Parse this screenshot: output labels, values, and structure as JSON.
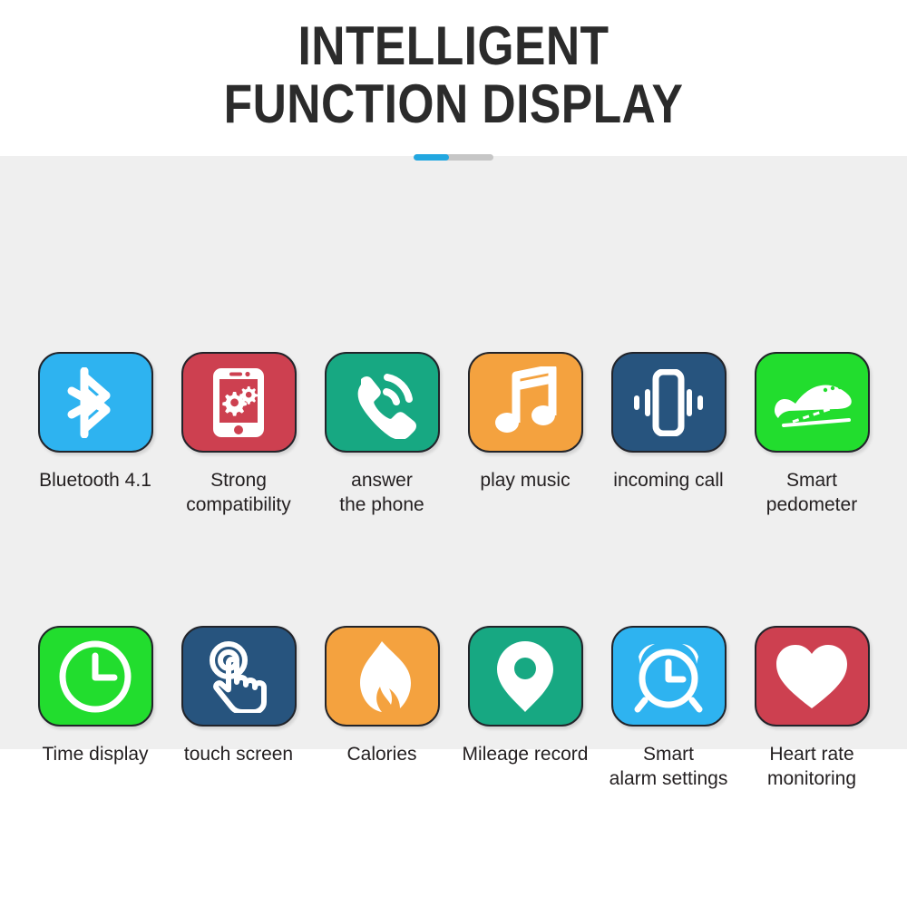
{
  "header": {
    "title_line_1": "INTELLIGENT",
    "title_line_2": "FUNCTION DISPLAY",
    "divider": {
      "fill_color": "#22a7e0",
      "track_color": "#c6c6c6",
      "fill_percent": 44
    }
  },
  "theme": {
    "page_background": "#ffffff",
    "panel_background": "#efefef",
    "title_color": "#2b2b2b",
    "label_color": "#231f20",
    "tile_outline": "#22242a",
    "icon_color": "#ffffff"
  },
  "features": [
    {
      "label": "Bluetooth 4.1",
      "icon": "bluetooth-icon",
      "color": "#2eb3f0"
    },
    {
      "label": "Strong\ncompatibility",
      "icon": "phone-gears-icon",
      "color": "#cd4050"
    },
    {
      "label": "answer\nthe phone",
      "icon": "answer-call-icon",
      "color": "#17a882"
    },
    {
      "label": "play music",
      "icon": "music-note-icon",
      "color": "#f4a23f"
    },
    {
      "label": "incoming call",
      "icon": "vibrating-phone-icon",
      "color": "#27547e"
    },
    {
      "label": "Smart\npedometer",
      "icon": "running-shoe-icon",
      "color": "#22dd2e"
    },
    {
      "label": "Time display",
      "icon": "clock-icon",
      "color": "#22dd2e"
    },
    {
      "label": "touch screen",
      "icon": "tap-hand-icon",
      "color": "#27547e"
    },
    {
      "label": "Calories",
      "icon": "flame-icon",
      "color": "#f4a23f"
    },
    {
      "label": "Mileage record",
      "icon": "map-pin-icon",
      "color": "#17a882"
    },
    {
      "label": "Smart\nalarm settings",
      "icon": "alarm-clock-icon",
      "color": "#2eb3f0"
    },
    {
      "label": "Heart rate\nmonitoring",
      "icon": "heart-icon",
      "color": "#cd4050"
    }
  ]
}
